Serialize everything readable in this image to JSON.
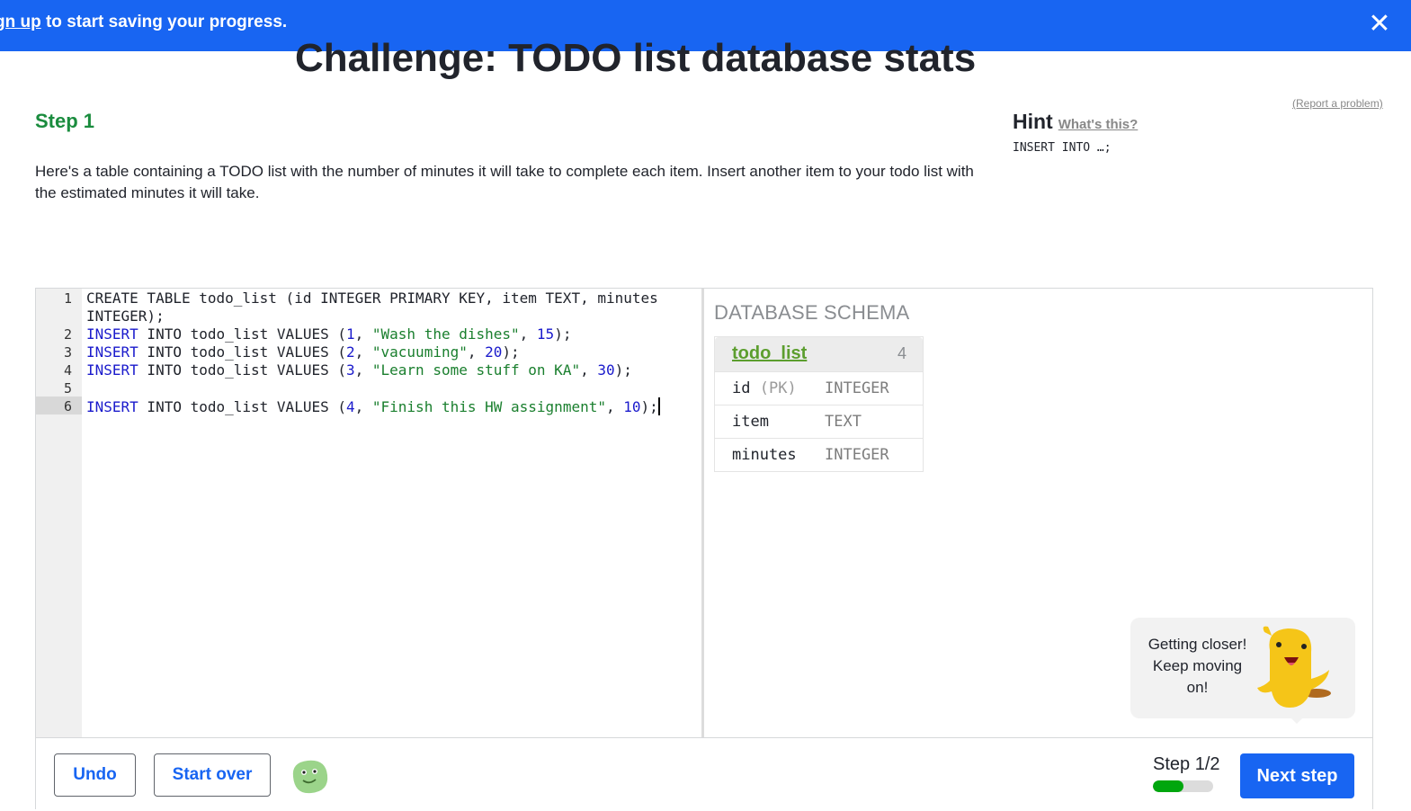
{
  "banner": {
    "link_text": "gn up",
    "text": " to start saving your progress.",
    "close_icon": "close-icon"
  },
  "challenge_title": "Challenge: TODO list database stats",
  "step": {
    "title": "Step 1",
    "description": "Here's a table containing a TODO list with the number of minutes it will take to complete each item. Insert another item to your todo list with the estimated minutes it will take."
  },
  "report_link": "(Report a problem)",
  "hint": {
    "title": "Hint",
    "link": "What's this?",
    "code": "INSERT INTO …;"
  },
  "editor": {
    "line_numbers": [
      "1",
      "2",
      "3",
      "4",
      "5",
      "6"
    ],
    "active_line": 6,
    "lines": [
      "CREATE TABLE todo_list (id INTEGER PRIMARY KEY, item TEXT, minutes",
      "INTEGER);",
      "INSERT INTO todo_list VALUES (1, \"Wash the dishes\", 15);",
      "INSERT INTO todo_list VALUES (2, \"vacuuming\", 20);",
      "INSERT INTO todo_list VALUES (3, \"Learn some stuff on KA\", 30);",
      "",
      "INSERT INTO todo_list VALUES (4, \"Finish this HW assignment\", 10);"
    ]
  },
  "schema": {
    "heading": "DATABASE SCHEMA",
    "table_name": "todo_list",
    "row_count": "4",
    "columns": [
      {
        "name": "id",
        "pk": "(PK)",
        "type": "INTEGER"
      },
      {
        "name": "item",
        "pk": "",
        "type": "TEXT"
      },
      {
        "name": "minutes",
        "pk": "",
        "type": "INTEGER"
      }
    ]
  },
  "feedback": {
    "line1": "Getting closer!",
    "line2": "Keep moving",
    "line3": "on!"
  },
  "footer": {
    "undo": "Undo",
    "start_over": "Start over",
    "step_count": "Step 1/2",
    "progress_fraction": 0.5,
    "next_step": "Next step"
  },
  "colors": {
    "banner": "#1865f2",
    "step_green": "#1a8c3e",
    "keyword": "#1a1acc",
    "string": "#1a7f2e",
    "progress": "#00a60e"
  }
}
